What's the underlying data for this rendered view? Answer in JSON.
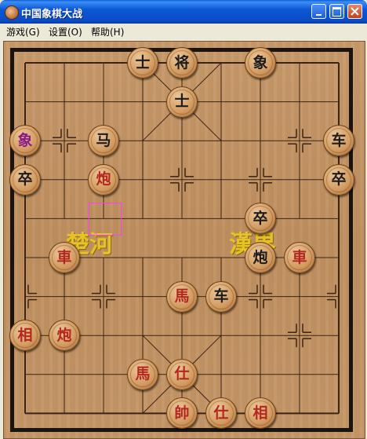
{
  "window": {
    "title": "中国象棋大战"
  },
  "menu": [
    {
      "label": "游戏(G)"
    },
    {
      "label": "设置(O)"
    },
    {
      "label": "帮助(H)"
    }
  ],
  "board": {
    "river_left": "楚河",
    "river_right": "漢界"
  },
  "pieces": [
    {
      "char": "士",
      "color": "black",
      "col": 3,
      "row": 0
    },
    {
      "char": "将",
      "color": "black",
      "col": 4,
      "row": 0
    },
    {
      "char": "象",
      "color": "black",
      "col": 6,
      "row": 0
    },
    {
      "char": "士",
      "color": "black",
      "col": 4,
      "row": 1
    },
    {
      "char": "象",
      "color": "purple",
      "col": 0,
      "row": 2
    },
    {
      "char": "马",
      "color": "black",
      "col": 2,
      "row": 2
    },
    {
      "char": "车",
      "color": "black",
      "col": 8,
      "row": 2
    },
    {
      "char": "卒",
      "color": "black",
      "col": 0,
      "row": 3
    },
    {
      "char": "炮",
      "color": "red",
      "col": 2,
      "row": 3
    },
    {
      "char": "卒",
      "color": "black",
      "col": 8,
      "row": 3
    },
    {
      "char": "卒",
      "color": "black",
      "col": 6,
      "row": 4
    },
    {
      "char": "車",
      "color": "red",
      "col": 1,
      "row": 5
    },
    {
      "char": "炮",
      "color": "black",
      "col": 6,
      "row": 5
    },
    {
      "char": "車",
      "color": "red",
      "col": 7,
      "row": 5
    },
    {
      "char": "馬",
      "color": "red",
      "col": 4,
      "row": 6
    },
    {
      "char": "车",
      "color": "black",
      "col": 5,
      "row": 6
    },
    {
      "char": "相",
      "color": "red",
      "col": 0,
      "row": 7
    },
    {
      "char": "炮",
      "color": "red",
      "col": 1,
      "row": 7
    },
    {
      "char": "馬",
      "color": "red",
      "col": 3,
      "row": 8
    },
    {
      "char": "仕",
      "color": "red",
      "col": 4,
      "row": 8
    },
    {
      "char": "帥",
      "color": "red",
      "col": 4,
      "row": 9
    },
    {
      "char": "仕",
      "color": "red",
      "col": 5,
      "row": 9
    },
    {
      "char": "相",
      "color": "red",
      "col": 6,
      "row": 9
    }
  ],
  "colors": {
    "black": "#1c1c1c",
    "red": "#b5261e",
    "purple": "#8a1c86",
    "selection": "#ff3cff"
  }
}
